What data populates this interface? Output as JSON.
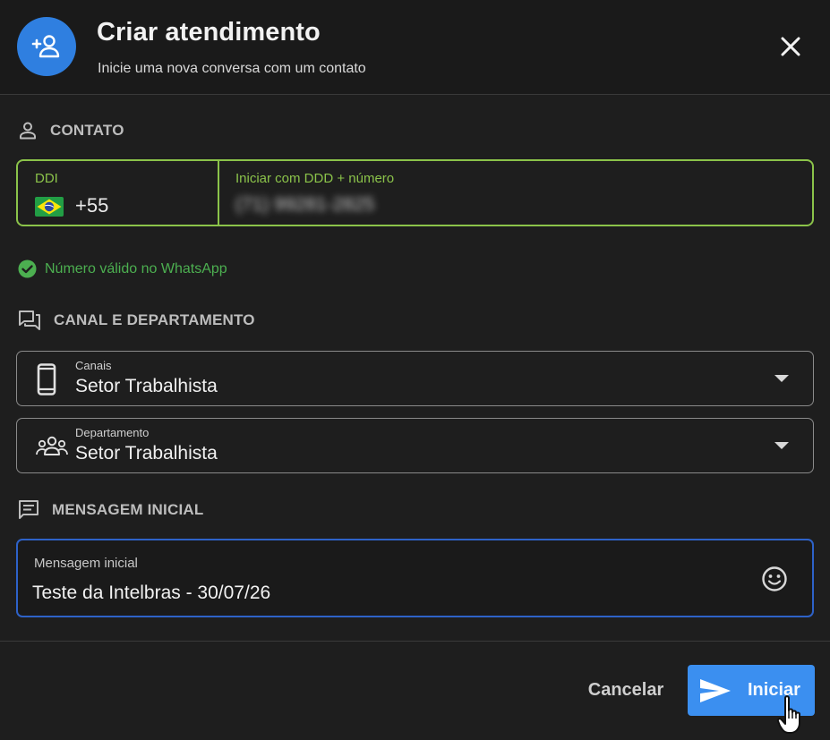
{
  "header": {
    "title": "Criar atendimento",
    "subtitle": "Inicie uma nova conversa com um contato",
    "avatar_icon": "person-add-icon",
    "close_icon": "close-icon"
  },
  "contact": {
    "section_label": "CONTATO",
    "ddi_label": "DDI",
    "ddi_value": "+55",
    "flag_icon": "brazil-flag-icon",
    "number_label": "Iniciar com DDD + número",
    "number_value": "(71) 99281-2825",
    "valid_message": "Número válido no WhatsApp"
  },
  "channel": {
    "section_label": "CANAL E DEPARTAMENTO",
    "canais_label": "Canais",
    "canais_value": "Setor Trabalhista",
    "departamento_label": "Departamento",
    "departamento_value": "Setor Trabalhista"
  },
  "message": {
    "section_label": "MENSAGEM INICIAL",
    "field_label": "Mensagem inicial",
    "field_value": "Teste da Intelbras - 30/07/26"
  },
  "footer": {
    "cancel_label": "Cancelar",
    "start_label": "Iniciar"
  },
  "colors": {
    "accent_blue": "#3b8ff0",
    "valid_green": "#8bc34a",
    "success_green": "#4caf50",
    "focus_blue": "#2e62c8"
  }
}
